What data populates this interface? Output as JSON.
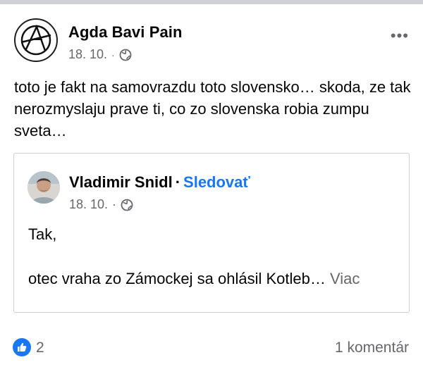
{
  "post": {
    "author": "Agda Bavi Pain",
    "date": "18. 10.",
    "meta_sep": "·",
    "audience_icon": "globe-icon",
    "more_label": "•••",
    "text": "toto je fakt na samovrazdu toto slovensko… skoda, ze tak nerozmyslaju prave ti, co zo slovenska robia zumpu sveta…"
  },
  "shared_post": {
    "author": "Vladimir Snidl",
    "separator": "·",
    "follow_label": "Sledovať",
    "date": "18. 10.",
    "meta_sep": "·",
    "audience_icon": "globe-icon",
    "line1": "Tak,",
    "line2": "otec vraha zo Zámockej sa ohlásil Kotleb…",
    "more_label": "Viac"
  },
  "footer": {
    "reaction_icon": "thumbs-up-icon",
    "reaction_count": "2",
    "comments_label": "1 komentár"
  },
  "colors": {
    "accent": "#1877f2",
    "secondary_text": "#65676b",
    "border": "#ced0d4"
  }
}
